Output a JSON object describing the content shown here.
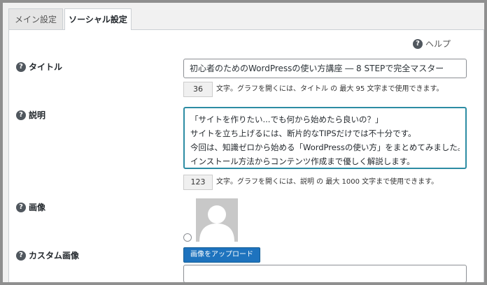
{
  "tabs": [
    {
      "label": "メイン設定"
    },
    {
      "label": "ソーシャル設定"
    }
  ],
  "help": {
    "label": "ヘルプ"
  },
  "fields": {
    "title": {
      "label": "タイトル",
      "value": "初心者のためのWordPressの使い方講座 ― 8 STEPで完全マスター",
      "count": "36",
      "note": "文字。グラフを開くには、タイトル の 最大 95 文字まで使用できます。"
    },
    "description": {
      "label": "説明",
      "lines": [
        "「サイトを作りたい...でも何から始めたら良いの？」",
        "サイトを立ち上げるには、断片的なTIPSだけでは不十分です。",
        "今回は、知識ゼロから始める「WordPressの使い方」をまとめてみました。",
        "インストール方法からコンテンツ作成まで優しく解説します。"
      ],
      "count": "123",
      "note": "文字。グラフを開くには、説明 の 最大 1000 文字まで使用できます。"
    },
    "image": {
      "label": "画像"
    },
    "custom_image": {
      "label": "カスタム画像",
      "button": "画像をアップロード",
      "value": ""
    }
  }
}
